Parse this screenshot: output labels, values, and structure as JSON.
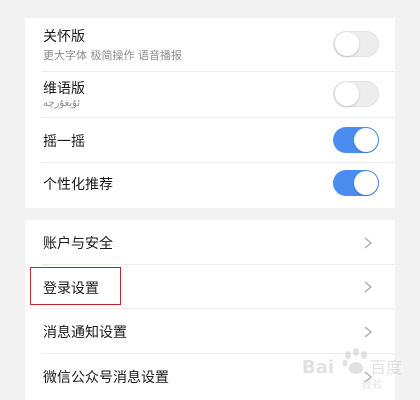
{
  "settings_top": {
    "items": [
      {
        "title": "关怀版",
        "subtitle": "更大字体 极简操作 语音播报",
        "enabled": false
      },
      {
        "title": "维语版",
        "subtitle": "ئۇيغۇرچە",
        "enabled": false
      },
      {
        "title": "摇一摇",
        "subtitle": "",
        "enabled": true
      },
      {
        "title": "个性化推荐",
        "subtitle": "",
        "enabled": true
      }
    ]
  },
  "settings_bottom": {
    "items": [
      {
        "title": "账户与安全"
      },
      {
        "title": "登录设置"
      },
      {
        "title": "消息通知设置"
      },
      {
        "title": "微信公众号消息设置"
      }
    ]
  },
  "watermark": {
    "brand": "Bai百度",
    "sub": "经验"
  },
  "colors": {
    "toggle_on": "#4a8cf0",
    "toggle_off": "#ededed",
    "highlight_border": "#c0262d",
    "background": "#f2f2f2"
  }
}
